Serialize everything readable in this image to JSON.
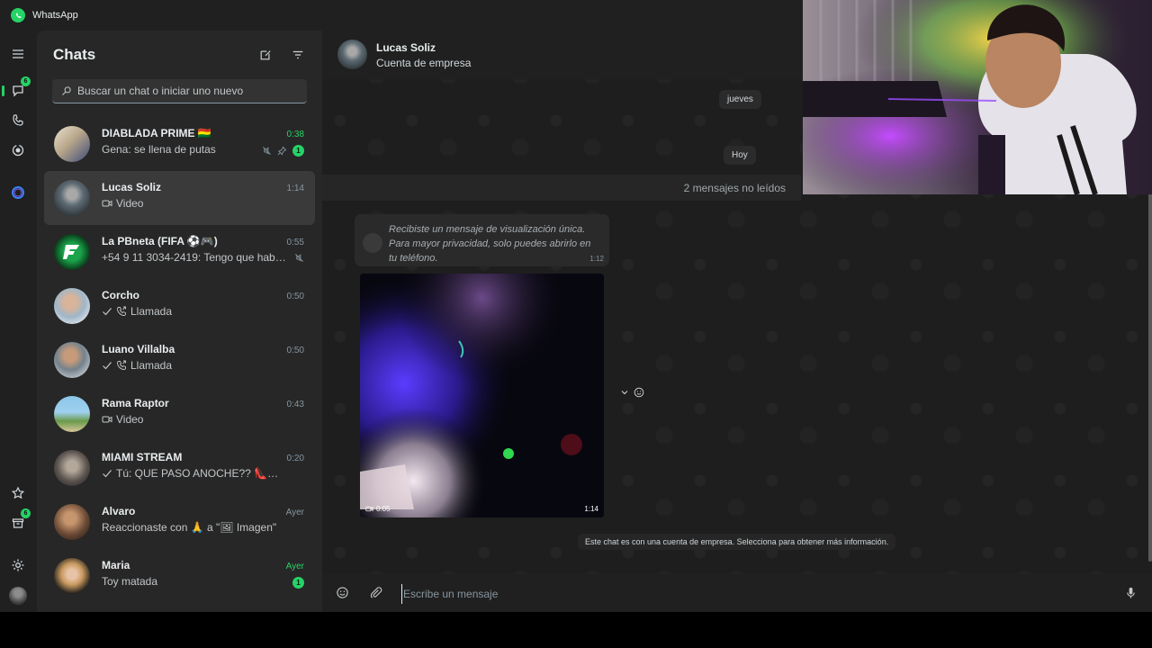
{
  "app": {
    "title": "WhatsApp",
    "accent": "#25d366"
  },
  "rail": {
    "chats_badge": "6",
    "updates_badge": "6"
  },
  "chat_panel": {
    "title": "Chats",
    "search_placeholder": "Buscar un chat o iniciar uno nuevo"
  },
  "chats": [
    {
      "name": "DIABLADA PRIME 🇧🇴",
      "time": "0:38",
      "message": "Gena: se llena de putas",
      "unread": "1",
      "muted": true,
      "pinned": true
    },
    {
      "name": "Lucas Soliz",
      "time": "1:14",
      "message": "Video",
      "selected": true
    },
    {
      "name": "La PBneta (FIFA ⚽🎮)",
      "time": "0:55",
      "message": "+54 9 11 3034-2419: Tengo que habla...",
      "muted": true
    },
    {
      "name": "Corcho",
      "time": "0:50",
      "message": "Llamada"
    },
    {
      "name": "Luano Villalba",
      "time": "0:50",
      "message": "Llamada"
    },
    {
      "name": "Rama Raptor",
      "time": "0:43",
      "message": "Video"
    },
    {
      "name": "MIAMI STREAM",
      "time": "0:20",
      "message": "Tú: QUE PASO ANOCHE?? 👠👀 ww..."
    },
    {
      "name": "Alvaro",
      "time": "Ayer",
      "message": "Reaccionaste con 🙏 a \"🖼 Imagen\""
    },
    {
      "name": "Maria",
      "time": "Ayer",
      "message": "Toy matada",
      "unread": "1"
    }
  ],
  "conversation": {
    "name": "Lucas Soliz",
    "subtitle": "Cuenta de empresa",
    "date_chip_1": "jueves",
    "date_chip_2": "Hoy",
    "unread_divider": "2 mensajes no leídos",
    "view_once_text": "Recibiste un mensaje de visualización única. Para mayor privacidad, solo puedes abrirlo en tu teléfono.",
    "view_once_time": "1:12",
    "video_duration": "0:05",
    "video_time": "1:14",
    "business_note": "Este chat es con una cuenta de empresa. Selecciona para obtener más información.",
    "composer_placeholder": "Escribe un mensaje"
  }
}
